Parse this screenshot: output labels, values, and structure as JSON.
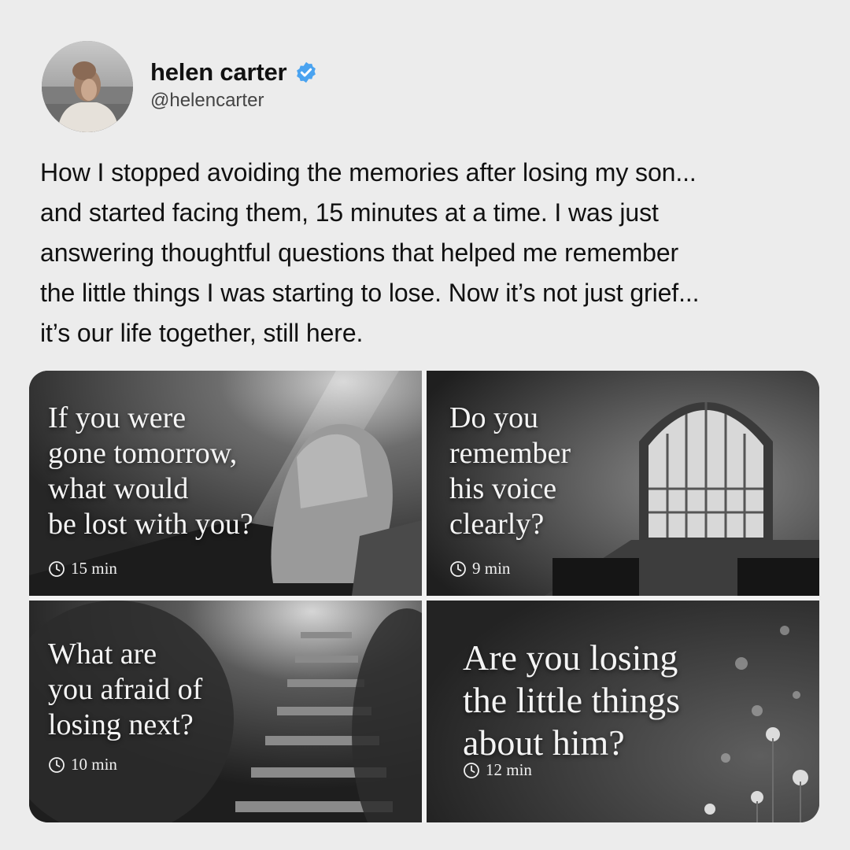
{
  "post": {
    "author_name": "helen carter",
    "author_handle": "@helencarter",
    "verified_icon": "verified-badge-icon",
    "body": "How I stopped avoiding the memories after losing my son...\nand started facing them, 15 minutes at a time. I was just\nanswering thoughtful questions that helped me remember\nthe little things I was starting to lose. Now it’s not just grief...\nit’s our life together, still here."
  },
  "cards": [
    {
      "question": "If you were\ngone tomorrow,\nwhat would\nbe lost with you?",
      "duration": "15 min",
      "image": "praying-hands"
    },
    {
      "question": "Do you\nremember\nhis voice\nclearly?",
      "duration": "9 min",
      "image": "church-stained-glass-window"
    },
    {
      "question": "What are\nyou afraid of\nlosing next?",
      "duration": "10 min",
      "image": "stone-stairs-with-flowers"
    },
    {
      "question": "Are you losing\nthe little things\nabout him?",
      "duration": "12 min",
      "image": "wildflowers"
    }
  ],
  "colors": {
    "verified": "#4aa3f0",
    "card_text": "#f4f4f4",
    "page_background": "#ececec"
  }
}
